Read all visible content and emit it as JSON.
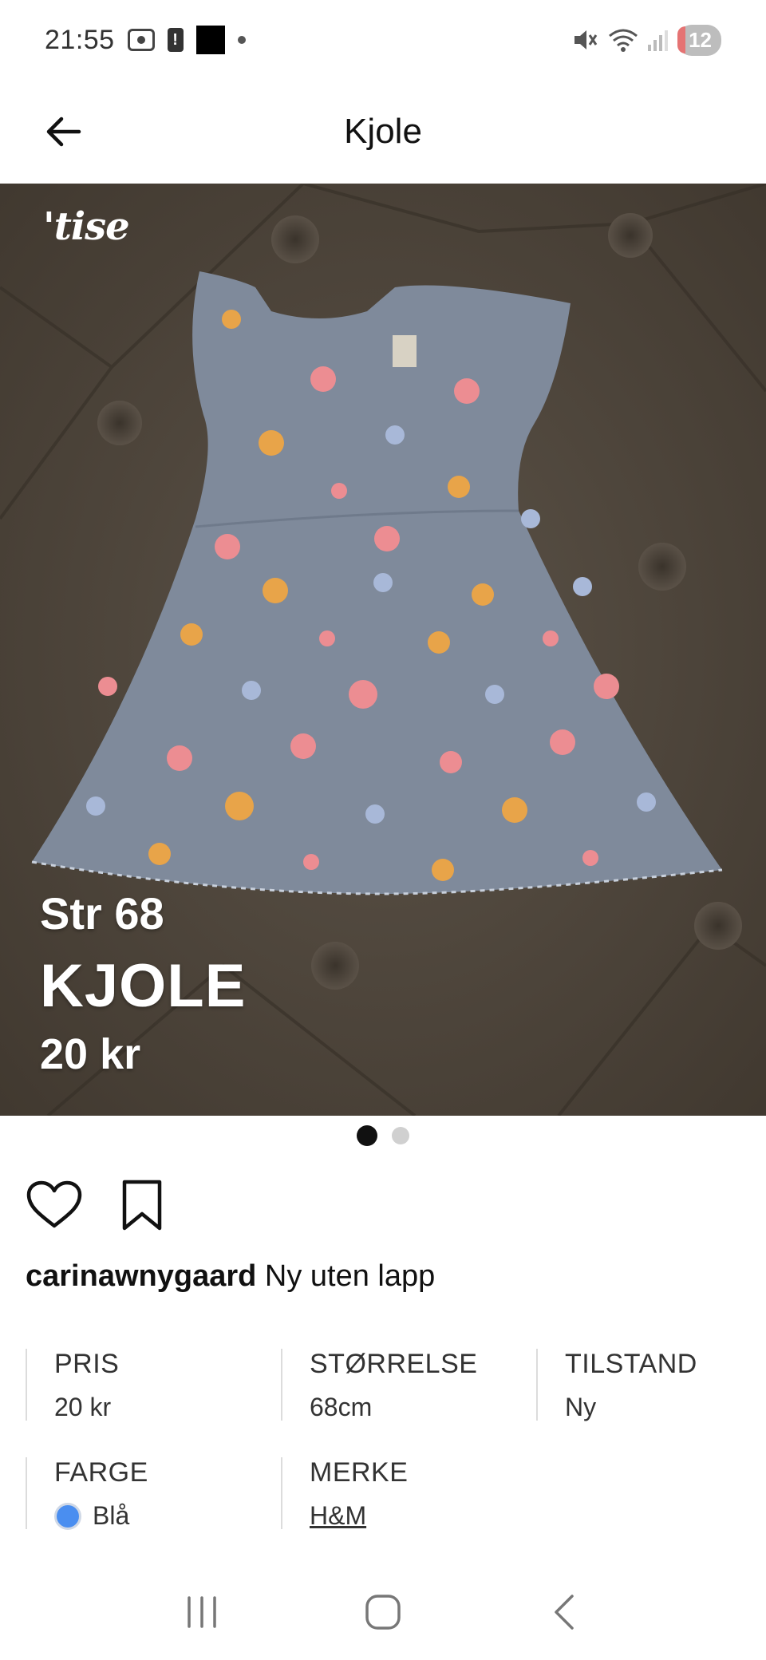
{
  "status_bar": {
    "time": "21:55",
    "notification_count": "12",
    "icons": [
      "screen-recorder-icon",
      "alert-icon",
      "app-icon",
      "dot-icon",
      "mute-icon",
      "wifi-icon",
      "signal-icon"
    ]
  },
  "app_bar": {
    "title": "Kjole",
    "back_icon": "arrow-left-icon"
  },
  "photo": {
    "logo": "'tise",
    "overlay_size": "Str 68",
    "overlay_title": "KJOLE",
    "overlay_price": "20 kr",
    "pages": 2,
    "active_page": 1
  },
  "actions": {
    "like_icon": "heart-icon",
    "save_icon": "bookmark-icon"
  },
  "caption": {
    "username": "carinawnygaard",
    "text": "Ny uten lapp"
  },
  "details": {
    "price_label": "PRIS",
    "price_value": "20 kr",
    "size_label": "STØRRELSE",
    "size_value": "68cm",
    "condition_label": "TILSTAND",
    "condition_value": "Ny",
    "color_label": "FARGE",
    "color_value": "Blå",
    "color_hex": "#4a8ef0",
    "brand_label": "MERKE",
    "brand_value": "H&M"
  },
  "nav_bar": {
    "icons": [
      "recent-apps-icon",
      "home-icon",
      "back-icon"
    ]
  }
}
